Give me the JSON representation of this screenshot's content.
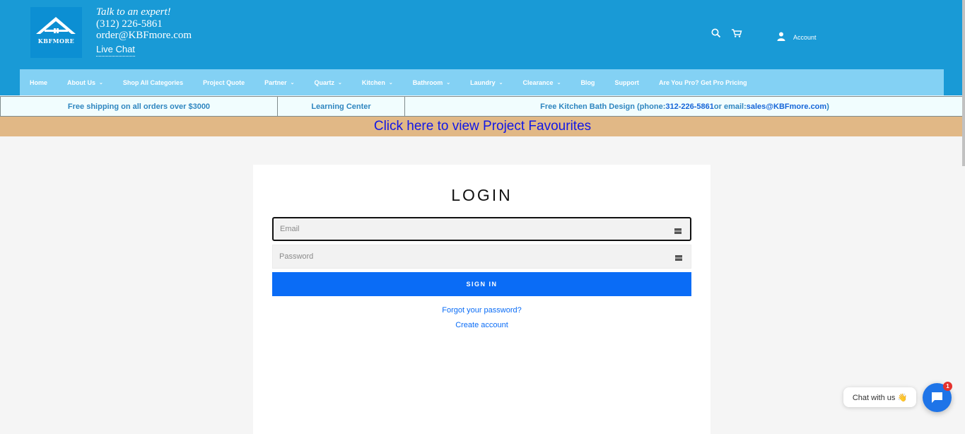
{
  "header": {
    "logo_text": "KBFMORE",
    "tagline": "Talk to an expert!",
    "phone": "(312) 226-5861",
    "email": "order@KBFmore.com",
    "live_chat": "Live Chat",
    "search_icon": "search-icon",
    "cart_icon": "cart-icon",
    "account_label": "Account"
  },
  "nav": {
    "items": [
      {
        "label": "Home",
        "dropdown": false
      },
      {
        "label": "About Us",
        "dropdown": true
      },
      {
        "label": "Shop All Categories",
        "dropdown": false
      },
      {
        "label": "Project Quote",
        "dropdown": false
      },
      {
        "label": "Partner",
        "dropdown": true
      },
      {
        "label": "Quartz",
        "dropdown": true
      },
      {
        "label": "Kitchen",
        "dropdown": true
      },
      {
        "label": "Bathroom",
        "dropdown": true
      },
      {
        "label": "Laundry",
        "dropdown": true
      },
      {
        "label": "Clearance",
        "dropdown": true
      },
      {
        "label": "Blog",
        "dropdown": false
      },
      {
        "label": "Support",
        "dropdown": false
      },
      {
        "label": "Are You Pro? Get Pro Pricing",
        "dropdown": false
      }
    ]
  },
  "infobar": {
    "shipping": "Free shipping on all orders over $3000",
    "learning": "Learning Center",
    "design_prefix": "Free Kitchen Bath Design (phone: ",
    "design_phone": "312-226-5861",
    "design_mid": " or email: ",
    "design_email": "sales@KBFmore.com",
    "design_suffix": ")"
  },
  "banner": {
    "favourites_link": "Click here to view Project Favourites"
  },
  "login": {
    "title": "LOGIN",
    "email_placeholder": "Email",
    "password_placeholder": "Password",
    "sign_in": "SIGN IN",
    "forgot": "Forgot your password?",
    "create": "Create account"
  },
  "chat": {
    "label": "Chat with us 👋",
    "badge": "1"
  },
  "colors": {
    "header_bg": "#199ad6",
    "nav_bg": "#83d1f4",
    "banner_bg": "#e1b886",
    "primary": "#0a6cf6"
  }
}
